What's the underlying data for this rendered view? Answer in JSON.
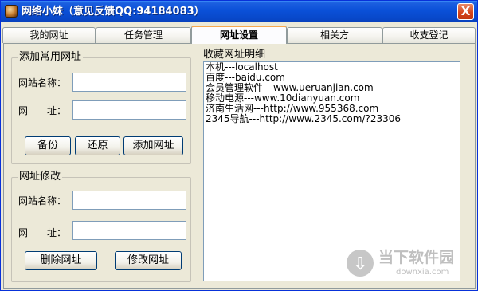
{
  "window": {
    "title": "网络小妹（意见反馈QQ:94184083）",
    "close_label": "X"
  },
  "tabs": [
    {
      "label": "我的网址",
      "active": false
    },
    {
      "label": "任务管理",
      "active": false
    },
    {
      "label": "网址设置",
      "active": true
    },
    {
      "label": "相关方",
      "active": false
    },
    {
      "label": "收支登记",
      "active": false
    }
  ],
  "add_group": {
    "title": "添加常用网址",
    "site_name_label": "网站名称：",
    "url_label": "网　　址：",
    "site_name_value": "",
    "url_value": "",
    "backup_button": "备份",
    "restore_button": "还原",
    "add_button": "添加网址"
  },
  "modify_group": {
    "title": "网址修改",
    "site_name_label": "网站名称：",
    "url_label": "网　　址：",
    "site_name_value": "",
    "url_value": "",
    "delete_button": "删除网址",
    "modify_button": "修改网址"
  },
  "favorites": {
    "title": "收藏网址明细",
    "lines": [
      "本机---localhost",
      "百度---baidu.com",
      "会员管理软件---www.ueruanjian.com",
      "移动电源---www.10dianyuan.com",
      "济南生活网---http://www.955368.com",
      "2345导航---http://www.2345.com/?23306"
    ]
  },
  "watermark": {
    "name": "当下软件园",
    "domain": "downxia.com"
  }
}
